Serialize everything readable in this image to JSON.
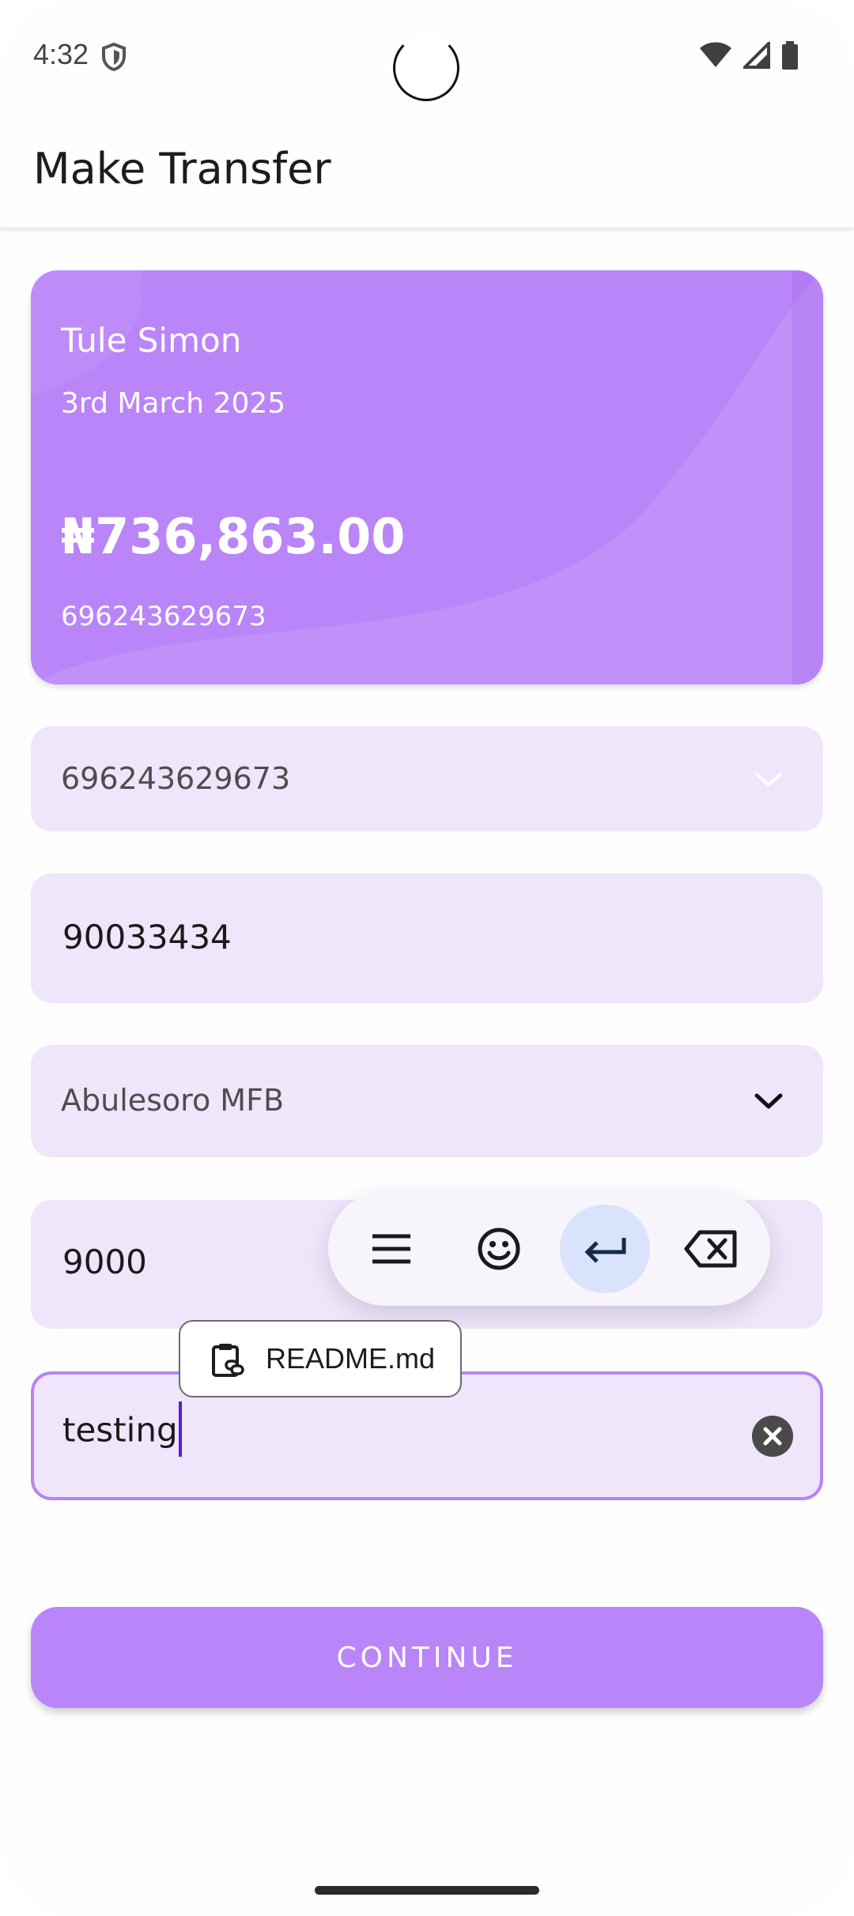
{
  "status_bar": {
    "time": "4:32",
    "icons": [
      "shield-icon",
      "wifi-icon",
      "signal-icon",
      "battery-icon"
    ]
  },
  "app_bar": {
    "title": "Make Transfer"
  },
  "account_card": {
    "name": "Tule Simon",
    "date": "3rd March 2025",
    "balance": "₦736,863.00",
    "account_number": "696243629673",
    "color": "#b985f8"
  },
  "form": {
    "source_account": {
      "value": "696243629673",
      "icon": "chevron-down-icon"
    },
    "recipient_account": {
      "value": "90033434"
    },
    "bank": {
      "value": "Abulesoro MFB",
      "icon": "chevron-down-icon"
    },
    "amount": {
      "value": "9000"
    },
    "narration": {
      "value": "testing",
      "icon": "clear-icon"
    }
  },
  "keyboard_toolbar": {
    "buttons": [
      "menu-icon",
      "emoji-icon",
      "enter-icon",
      "backspace-icon"
    ],
    "active": "enter-icon"
  },
  "clipboard_suggestion": {
    "label": "README.md",
    "icon": "clipboard-link-icon"
  },
  "continue_button": {
    "label": "CONTINUE"
  },
  "colors": {
    "accent": "#b985f8",
    "field_bg": "#efe6fb",
    "focus_border": "#b784f2",
    "cursor": "#5a1ed6"
  }
}
